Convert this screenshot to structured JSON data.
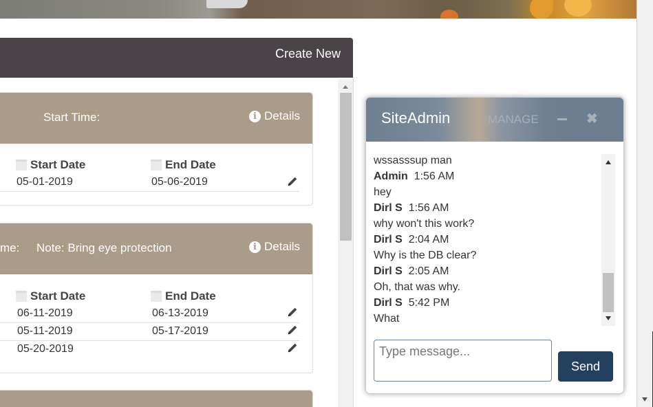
{
  "header": {
    "create_new_label": "Create New"
  },
  "cards": [
    {
      "head_left": "Start Time:",
      "details_label": "Details",
      "col_start": "Start Date",
      "col_end": "End Date",
      "rows": [
        {
          "start": "05-01-2019",
          "end": "05-06-2019"
        }
      ]
    },
    {
      "head_left": "me:",
      "head_note": "Note: Bring eye protection",
      "details_label": "Details",
      "col_start": "Start Date",
      "col_end": "End Date",
      "rows": [
        {
          "start": "06-11-2019",
          "end": "06-13-2019"
        },
        {
          "start": "05-11-2019",
          "end": "05-17-2019"
        },
        {
          "start": "05-20-2019",
          "end": ""
        }
      ]
    }
  ],
  "chat": {
    "title": "SiteAdmin",
    "manage_label": "MANAGE",
    "messages": [
      {
        "sender": "",
        "time": "",
        "text": "wssasssup man"
      },
      {
        "sender": "Admin",
        "time": "1:56 AM",
        "text": ""
      },
      {
        "sender": "",
        "time": "",
        "text": "hey"
      },
      {
        "sender": "Dirl S",
        "time": "1:56 AM",
        "text": ""
      },
      {
        "sender": "",
        "time": "",
        "text": "why won't this work?"
      },
      {
        "sender": "Dirl S",
        "time": "2:04 AM",
        "text": ""
      },
      {
        "sender": "",
        "time": "",
        "text": "Why is the DB clear?"
      },
      {
        "sender": "Dirl S",
        "time": "2:05 AM",
        "text": ""
      },
      {
        "sender": "",
        "time": "",
        "text": "Oh, that was why."
      },
      {
        "sender": "Dirl S",
        "time": "5:42 PM",
        "text": ""
      },
      {
        "sender": "",
        "time": "",
        "text": "What"
      }
    ],
    "input_placeholder": "Type message...",
    "send_label": "Send"
  },
  "colors": {
    "panel_header": "#4a4348",
    "card_header": "#a99c88",
    "send_button": "#23415f"
  }
}
